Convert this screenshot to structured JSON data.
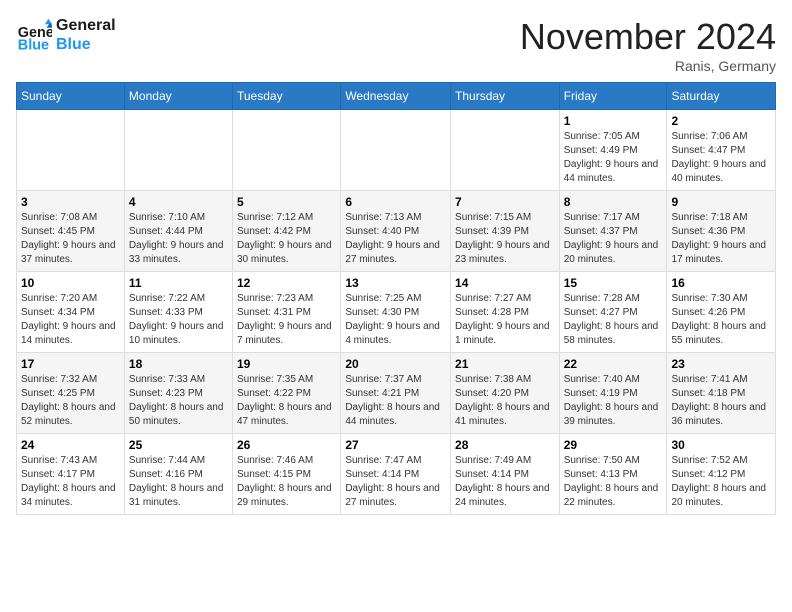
{
  "header": {
    "logo_line1": "General",
    "logo_line2": "Blue",
    "month_title": "November 2024",
    "location": "Ranis, Germany"
  },
  "weekdays": [
    "Sunday",
    "Monday",
    "Tuesday",
    "Wednesday",
    "Thursday",
    "Friday",
    "Saturday"
  ],
  "weeks": [
    [
      {
        "day": "",
        "sunrise": "",
        "sunset": "",
        "daylight": ""
      },
      {
        "day": "",
        "sunrise": "",
        "sunset": "",
        "daylight": ""
      },
      {
        "day": "",
        "sunrise": "",
        "sunset": "",
        "daylight": ""
      },
      {
        "day": "",
        "sunrise": "",
        "sunset": "",
        "daylight": ""
      },
      {
        "day": "",
        "sunrise": "",
        "sunset": "",
        "daylight": ""
      },
      {
        "day": "1",
        "sunrise": "Sunrise: 7:05 AM",
        "sunset": "Sunset: 4:49 PM",
        "daylight": "Daylight: 9 hours and 44 minutes."
      },
      {
        "day": "2",
        "sunrise": "Sunrise: 7:06 AM",
        "sunset": "Sunset: 4:47 PM",
        "daylight": "Daylight: 9 hours and 40 minutes."
      }
    ],
    [
      {
        "day": "3",
        "sunrise": "Sunrise: 7:08 AM",
        "sunset": "Sunset: 4:45 PM",
        "daylight": "Daylight: 9 hours and 37 minutes."
      },
      {
        "day": "4",
        "sunrise": "Sunrise: 7:10 AM",
        "sunset": "Sunset: 4:44 PM",
        "daylight": "Daylight: 9 hours and 33 minutes."
      },
      {
        "day": "5",
        "sunrise": "Sunrise: 7:12 AM",
        "sunset": "Sunset: 4:42 PM",
        "daylight": "Daylight: 9 hours and 30 minutes."
      },
      {
        "day": "6",
        "sunrise": "Sunrise: 7:13 AM",
        "sunset": "Sunset: 4:40 PM",
        "daylight": "Daylight: 9 hours and 27 minutes."
      },
      {
        "day": "7",
        "sunrise": "Sunrise: 7:15 AM",
        "sunset": "Sunset: 4:39 PM",
        "daylight": "Daylight: 9 hours and 23 minutes."
      },
      {
        "day": "8",
        "sunrise": "Sunrise: 7:17 AM",
        "sunset": "Sunset: 4:37 PM",
        "daylight": "Daylight: 9 hours and 20 minutes."
      },
      {
        "day": "9",
        "sunrise": "Sunrise: 7:18 AM",
        "sunset": "Sunset: 4:36 PM",
        "daylight": "Daylight: 9 hours and 17 minutes."
      }
    ],
    [
      {
        "day": "10",
        "sunrise": "Sunrise: 7:20 AM",
        "sunset": "Sunset: 4:34 PM",
        "daylight": "Daylight: 9 hours and 14 minutes."
      },
      {
        "day": "11",
        "sunrise": "Sunrise: 7:22 AM",
        "sunset": "Sunset: 4:33 PM",
        "daylight": "Daylight: 9 hours and 10 minutes."
      },
      {
        "day": "12",
        "sunrise": "Sunrise: 7:23 AM",
        "sunset": "Sunset: 4:31 PM",
        "daylight": "Daylight: 9 hours and 7 minutes."
      },
      {
        "day": "13",
        "sunrise": "Sunrise: 7:25 AM",
        "sunset": "Sunset: 4:30 PM",
        "daylight": "Daylight: 9 hours and 4 minutes."
      },
      {
        "day": "14",
        "sunrise": "Sunrise: 7:27 AM",
        "sunset": "Sunset: 4:28 PM",
        "daylight": "Daylight: 9 hours and 1 minute."
      },
      {
        "day": "15",
        "sunrise": "Sunrise: 7:28 AM",
        "sunset": "Sunset: 4:27 PM",
        "daylight": "Daylight: 8 hours and 58 minutes."
      },
      {
        "day": "16",
        "sunrise": "Sunrise: 7:30 AM",
        "sunset": "Sunset: 4:26 PM",
        "daylight": "Daylight: 8 hours and 55 minutes."
      }
    ],
    [
      {
        "day": "17",
        "sunrise": "Sunrise: 7:32 AM",
        "sunset": "Sunset: 4:25 PM",
        "daylight": "Daylight: 8 hours and 52 minutes."
      },
      {
        "day": "18",
        "sunrise": "Sunrise: 7:33 AM",
        "sunset": "Sunset: 4:23 PM",
        "daylight": "Daylight: 8 hours and 50 minutes."
      },
      {
        "day": "19",
        "sunrise": "Sunrise: 7:35 AM",
        "sunset": "Sunset: 4:22 PM",
        "daylight": "Daylight: 8 hours and 47 minutes."
      },
      {
        "day": "20",
        "sunrise": "Sunrise: 7:37 AM",
        "sunset": "Sunset: 4:21 PM",
        "daylight": "Daylight: 8 hours and 44 minutes."
      },
      {
        "day": "21",
        "sunrise": "Sunrise: 7:38 AM",
        "sunset": "Sunset: 4:20 PM",
        "daylight": "Daylight: 8 hours and 41 minutes."
      },
      {
        "day": "22",
        "sunrise": "Sunrise: 7:40 AM",
        "sunset": "Sunset: 4:19 PM",
        "daylight": "Daylight: 8 hours and 39 minutes."
      },
      {
        "day": "23",
        "sunrise": "Sunrise: 7:41 AM",
        "sunset": "Sunset: 4:18 PM",
        "daylight": "Daylight: 8 hours and 36 minutes."
      }
    ],
    [
      {
        "day": "24",
        "sunrise": "Sunrise: 7:43 AM",
        "sunset": "Sunset: 4:17 PM",
        "daylight": "Daylight: 8 hours and 34 minutes."
      },
      {
        "day": "25",
        "sunrise": "Sunrise: 7:44 AM",
        "sunset": "Sunset: 4:16 PM",
        "daylight": "Daylight: 8 hours and 31 minutes."
      },
      {
        "day": "26",
        "sunrise": "Sunrise: 7:46 AM",
        "sunset": "Sunset: 4:15 PM",
        "daylight": "Daylight: 8 hours and 29 minutes."
      },
      {
        "day": "27",
        "sunrise": "Sunrise: 7:47 AM",
        "sunset": "Sunset: 4:14 PM",
        "daylight": "Daylight: 8 hours and 27 minutes."
      },
      {
        "day": "28",
        "sunrise": "Sunrise: 7:49 AM",
        "sunset": "Sunset: 4:14 PM",
        "daylight": "Daylight: 8 hours and 24 minutes."
      },
      {
        "day": "29",
        "sunrise": "Sunrise: 7:50 AM",
        "sunset": "Sunset: 4:13 PM",
        "daylight": "Daylight: 8 hours and 22 minutes."
      },
      {
        "day": "30",
        "sunrise": "Sunrise: 7:52 AM",
        "sunset": "Sunset: 4:12 PM",
        "daylight": "Daylight: 8 hours and 20 minutes."
      }
    ]
  ]
}
